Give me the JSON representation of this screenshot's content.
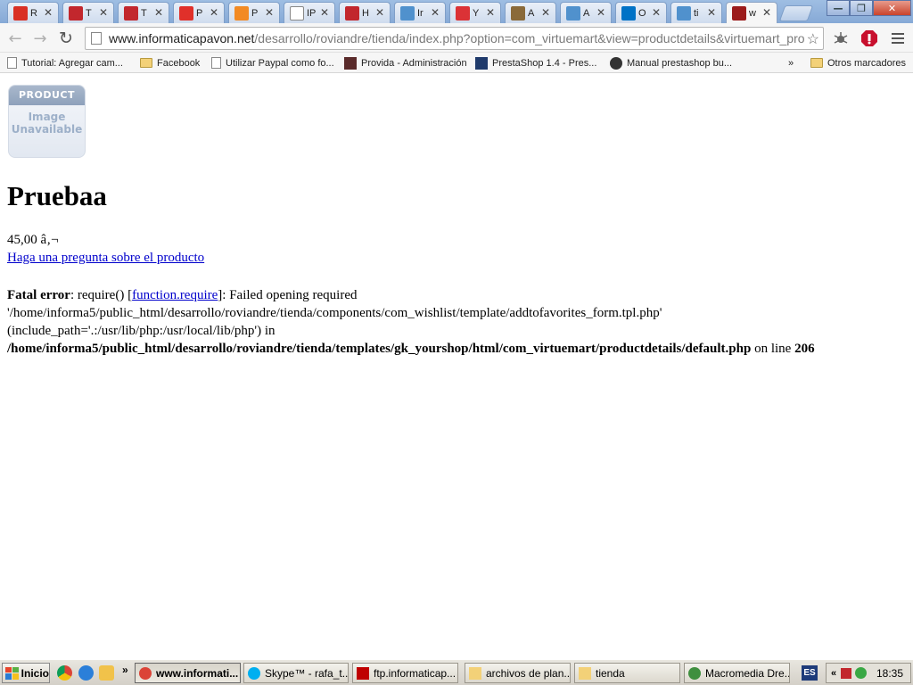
{
  "browser": {
    "tabs": [
      {
        "label": "R",
        "icon": "gmail-icon",
        "color": "#d93025"
      },
      {
        "label": "T",
        "icon": "red-logo-icon",
        "color": "#c2272d"
      },
      {
        "label": "T",
        "icon": "red-logo-icon",
        "color": "#c2272d"
      },
      {
        "label": "P",
        "icon": "w-logo-icon",
        "color": "#e0302a"
      },
      {
        "label": "P",
        "icon": "orange-circle-icon",
        "color": "#f28a24"
      },
      {
        "label": "IP",
        "icon": "page-icon",
        "color": "#ffffff"
      },
      {
        "label": "H",
        "icon": "red-logo-icon",
        "color": "#c2272d"
      },
      {
        "label": "Ir",
        "icon": "joomla-icon",
        "color": "#5091cd"
      },
      {
        "label": "Y",
        "icon": "map-pin-icon",
        "color": "#db3236"
      },
      {
        "label": "A",
        "icon": "monkey-icon",
        "color": "#8a6a3a"
      },
      {
        "label": "A",
        "icon": "joomla-icon",
        "color": "#5091cd"
      },
      {
        "label": "O",
        "icon": "outlook-icon",
        "color": "#0072c6"
      },
      {
        "label": "ti",
        "icon": "joomla-icon",
        "color": "#5091cd"
      },
      {
        "label": "w",
        "icon": "site-logo-icon",
        "color": "#9b1b1b",
        "active": true
      }
    ],
    "tab_close": "✕",
    "window": {
      "minimize": "—",
      "restore": "❐",
      "close": "✕"
    }
  },
  "toolbar": {
    "back": "←",
    "forward": "→",
    "reload": "↻",
    "url_host": "www.informaticapavon.net",
    "url_path": "/desarrollo/roviandre/tienda/index.php?option=com_virtuemart&view=productdetails&virtuemart_pro",
    "star": "☆"
  },
  "bookmarks": [
    {
      "label": "Tutorial: Agregar cam...",
      "icon": "page-icon"
    },
    {
      "label": "Facebook",
      "icon": "folder-icon"
    },
    {
      "label": "Utilizar Paypal como fo...",
      "icon": "page-icon"
    },
    {
      "label": "Provida - Administración",
      "icon": "provida-icon"
    },
    {
      "label": "PrestaShop 1.4 - Pres...",
      "icon": "prestashop-icon"
    },
    {
      "label": "Manual prestashop bu...",
      "icon": "scribd-icon"
    }
  ],
  "bookmarks_more": "»",
  "bookmarks_other": "Otros marcadores",
  "page": {
    "image_band": "PRODUCT",
    "image_line1": "Image",
    "image_line2": "Unavailable",
    "title": "Pruebaa",
    "price": "45,00 â‚¬",
    "ask_link": "Haga una pregunta sobre el producto",
    "error": {
      "label": "Fatal error",
      "part1": ": require() [",
      "link": "function.require",
      "part2": "]: Failed opening required '/home/informa5/public_html/desarrollo/roviandre/tienda/components/com_wishlist/template/addtofavorites_form.tpl.php' (include_path='.:/usr/lib/php:/usr/local/lib/php') in ",
      "file": "/home/informa5/public_html/desarrollo/roviandre/tienda/templates/gk_yourshop/html/com_virtuemart/productdetails/default.php",
      "part3": " on line ",
      "line": "206"
    }
  },
  "taskbar": {
    "start": "Inicio",
    "expand": "»",
    "tasks": [
      {
        "label": "www.informati...",
        "icon": "chrome-icon",
        "active": true
      },
      {
        "label": "Skype™ - rafa_t...",
        "icon": "skype-icon"
      },
      {
        "label": "ftp.informaticap...",
        "icon": "filezilla-icon"
      },
      {
        "label": "archivos de plan...",
        "icon": "folder-icon"
      },
      {
        "label": "tienda",
        "icon": "folder-icon"
      },
      {
        "label": "Macromedia Dre...",
        "icon": "dreamweaver-icon"
      }
    ],
    "lang": "ES",
    "tray_expand": "«",
    "clock": "18:35"
  }
}
